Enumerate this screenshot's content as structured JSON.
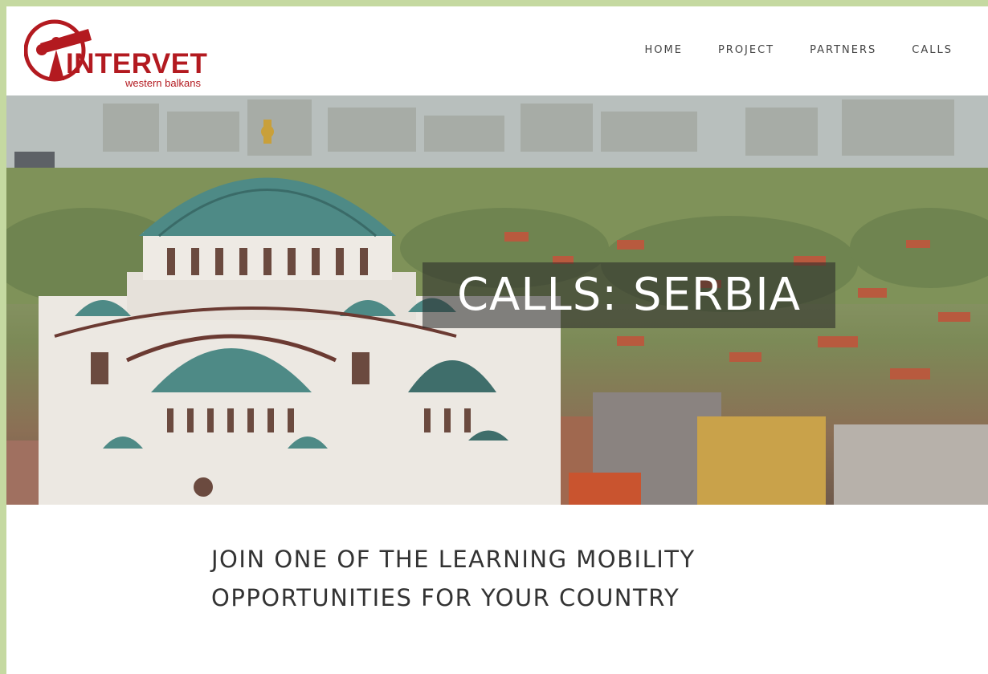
{
  "logo": {
    "word": "INTERVET",
    "subtitle": "western balkans",
    "color": "#b31a20"
  },
  "nav": {
    "items": [
      {
        "label": "HOME"
      },
      {
        "label": "PROJECT"
      },
      {
        "label": "PARTNERS"
      },
      {
        "label": "CALLS"
      }
    ]
  },
  "hero": {
    "title": "CALLS: SERBIA",
    "image_subject": "cathedral-dome-city-panorama"
  },
  "main": {
    "heading": "JOIN ONE OF THE LEARNING MOBILITY OPPORTUNITIES FOR YOUR COUNTRY"
  },
  "colors": {
    "page_border": "#c5d9a1",
    "brand_red": "#b31a20",
    "nav_text": "#444444"
  }
}
